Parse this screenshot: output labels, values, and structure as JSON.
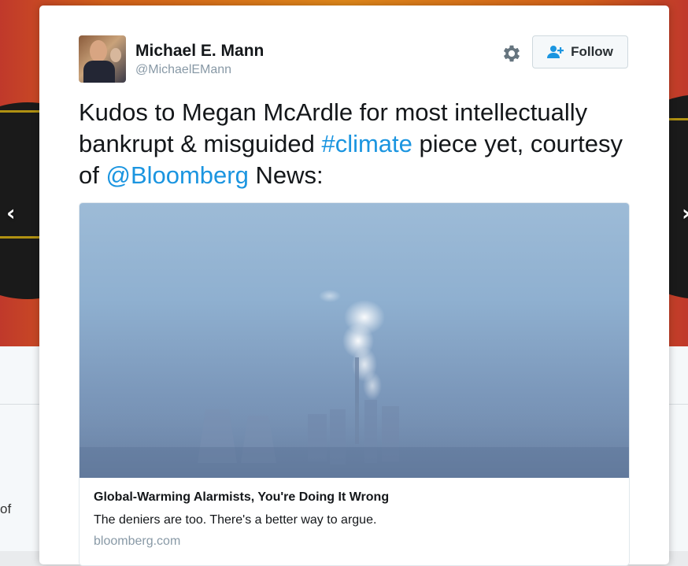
{
  "background": {
    "fragment_text": "of",
    "prev_arrow": "‹",
    "next_arrow": "›"
  },
  "tweet": {
    "author_name": "Michael E. Mann",
    "author_handle": "@MichaelEMann",
    "follow_label": "Follow",
    "text": {
      "part1": "Kudos to Megan McArdle for most intellectually bankrupt & misguided ",
      "hashtag": "#climate",
      "part2": " piece yet, courtesy of ",
      "mention": "@Bloomberg",
      "part3": " News:"
    },
    "card": {
      "title": "Global-Warming Alarmists, You're Doing It Wrong",
      "description": "The deniers are too. There's a better way to argue.",
      "domain": "bloomberg.com"
    }
  },
  "colors": {
    "link": "#1b95e0",
    "text": "#14171a",
    "muted": "#8899a6"
  }
}
